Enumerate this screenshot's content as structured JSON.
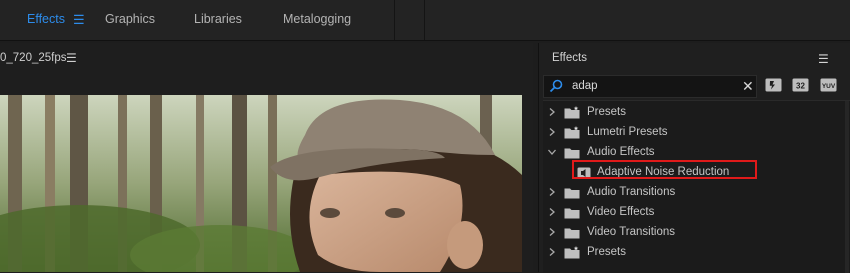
{
  "workspace_tabs": [
    {
      "label": "Effects",
      "active": true
    },
    {
      "label": "Graphics",
      "active": false
    },
    {
      "label": "Libraries",
      "active": false
    },
    {
      "label": "Metalogging",
      "active": false
    }
  ],
  "monitor": {
    "title": "0_720_25fps"
  },
  "effects_panel": {
    "title": "Effects",
    "search": {
      "value": "adap"
    },
    "filters": [
      {
        "label": "",
        "icon": "accelerated-effects-icon"
      },
      {
        "label": "32",
        "icon": "32-bit-color-icon"
      },
      {
        "label": "YUV",
        "icon": "yuv-icon"
      }
    ],
    "tree": [
      {
        "label": "Presets",
        "type": "preset-folder",
        "expanded": false,
        "indent": 0
      },
      {
        "label": "Lumetri Presets",
        "type": "preset-folder",
        "expanded": false,
        "indent": 0
      },
      {
        "label": "Audio Effects",
        "type": "folder",
        "expanded": true,
        "indent": 0
      },
      {
        "label": "Adaptive Noise Reduction",
        "type": "effect",
        "indent": 1
      },
      {
        "label": "Audio Transitions",
        "type": "folder",
        "expanded": false,
        "indent": 0
      },
      {
        "label": "Video Effects",
        "type": "folder",
        "expanded": false,
        "indent": 0
      },
      {
        "label": "Video Transitions",
        "type": "folder",
        "expanded": false,
        "indent": 0
      },
      {
        "label": "Presets",
        "type": "preset-folder",
        "expanded": false,
        "indent": 0
      }
    ]
  },
  "colors": {
    "accent": "#2d8ceb",
    "highlight": "#e01a1a"
  }
}
